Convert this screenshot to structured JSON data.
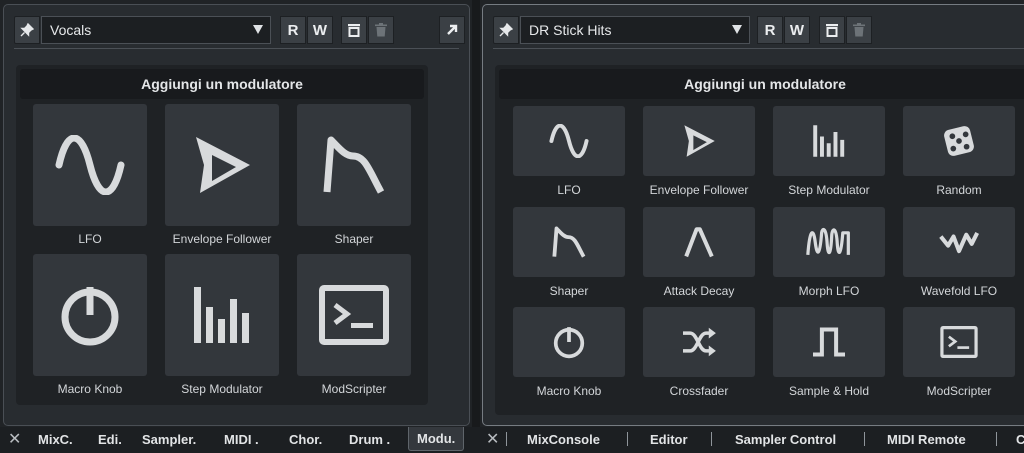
{
  "left_panel": {
    "track_name": "Vocals",
    "read_label": "R",
    "write_label": "W",
    "header": "Aggiungi un modulatore",
    "tiles": [
      {
        "label": "LFO",
        "icon": "sine-wave-icon"
      },
      {
        "label": "Envelope Follower",
        "icon": "envelope-follower-icon"
      },
      {
        "label": "Shaper",
        "icon": "shaper-icon"
      },
      {
        "label": "Macro Knob",
        "icon": "power-knob-icon"
      },
      {
        "label": "Step Modulator",
        "icon": "step-bars-icon"
      },
      {
        "label": "ModScripter",
        "icon": "terminal-icon"
      }
    ]
  },
  "right_panel": {
    "track_name": "DR Stick Hits",
    "read_label": "R",
    "write_label": "W",
    "header": "Aggiungi un modulatore",
    "tiles": [
      {
        "label": "LFO",
        "icon": "sine-wave-icon"
      },
      {
        "label": "Envelope Follower",
        "icon": "envelope-follower-icon"
      },
      {
        "label": "Step Modulator",
        "icon": "step-bars-icon"
      },
      {
        "label": "Random",
        "icon": "dice-icon"
      },
      {
        "label": "Shaper",
        "icon": "shaper-icon"
      },
      {
        "label": "Attack Decay",
        "icon": "attack-decay-icon"
      },
      {
        "label": "Morph LFO",
        "icon": "morph-lfo-icon"
      },
      {
        "label": "Wavefold LFO",
        "icon": "wavefold-icon"
      },
      {
        "label": "Macro Knob",
        "icon": "power-knob-icon"
      },
      {
        "label": "Crossfader",
        "icon": "shuffle-icon"
      },
      {
        "label": "Sample & Hold",
        "icon": "sample-hold-icon"
      },
      {
        "label": "ModScripter",
        "icon": "terminal-icon"
      }
    ]
  },
  "bottom_tabs_left": [
    "MixC.",
    "Edi.",
    "Sampler.",
    "MIDI .",
    "Chor.",
    "Drum .",
    "Modu."
  ],
  "bottom_tabs_right": [
    "MixConsole",
    "Editor",
    "Sampler Control",
    "MIDI Remote",
    "C"
  ],
  "close_symbol": "✕",
  "colors": {
    "background": "#202326",
    "tile": "#33373c",
    "icon": "#d8dadc",
    "header": "#181a1d"
  }
}
